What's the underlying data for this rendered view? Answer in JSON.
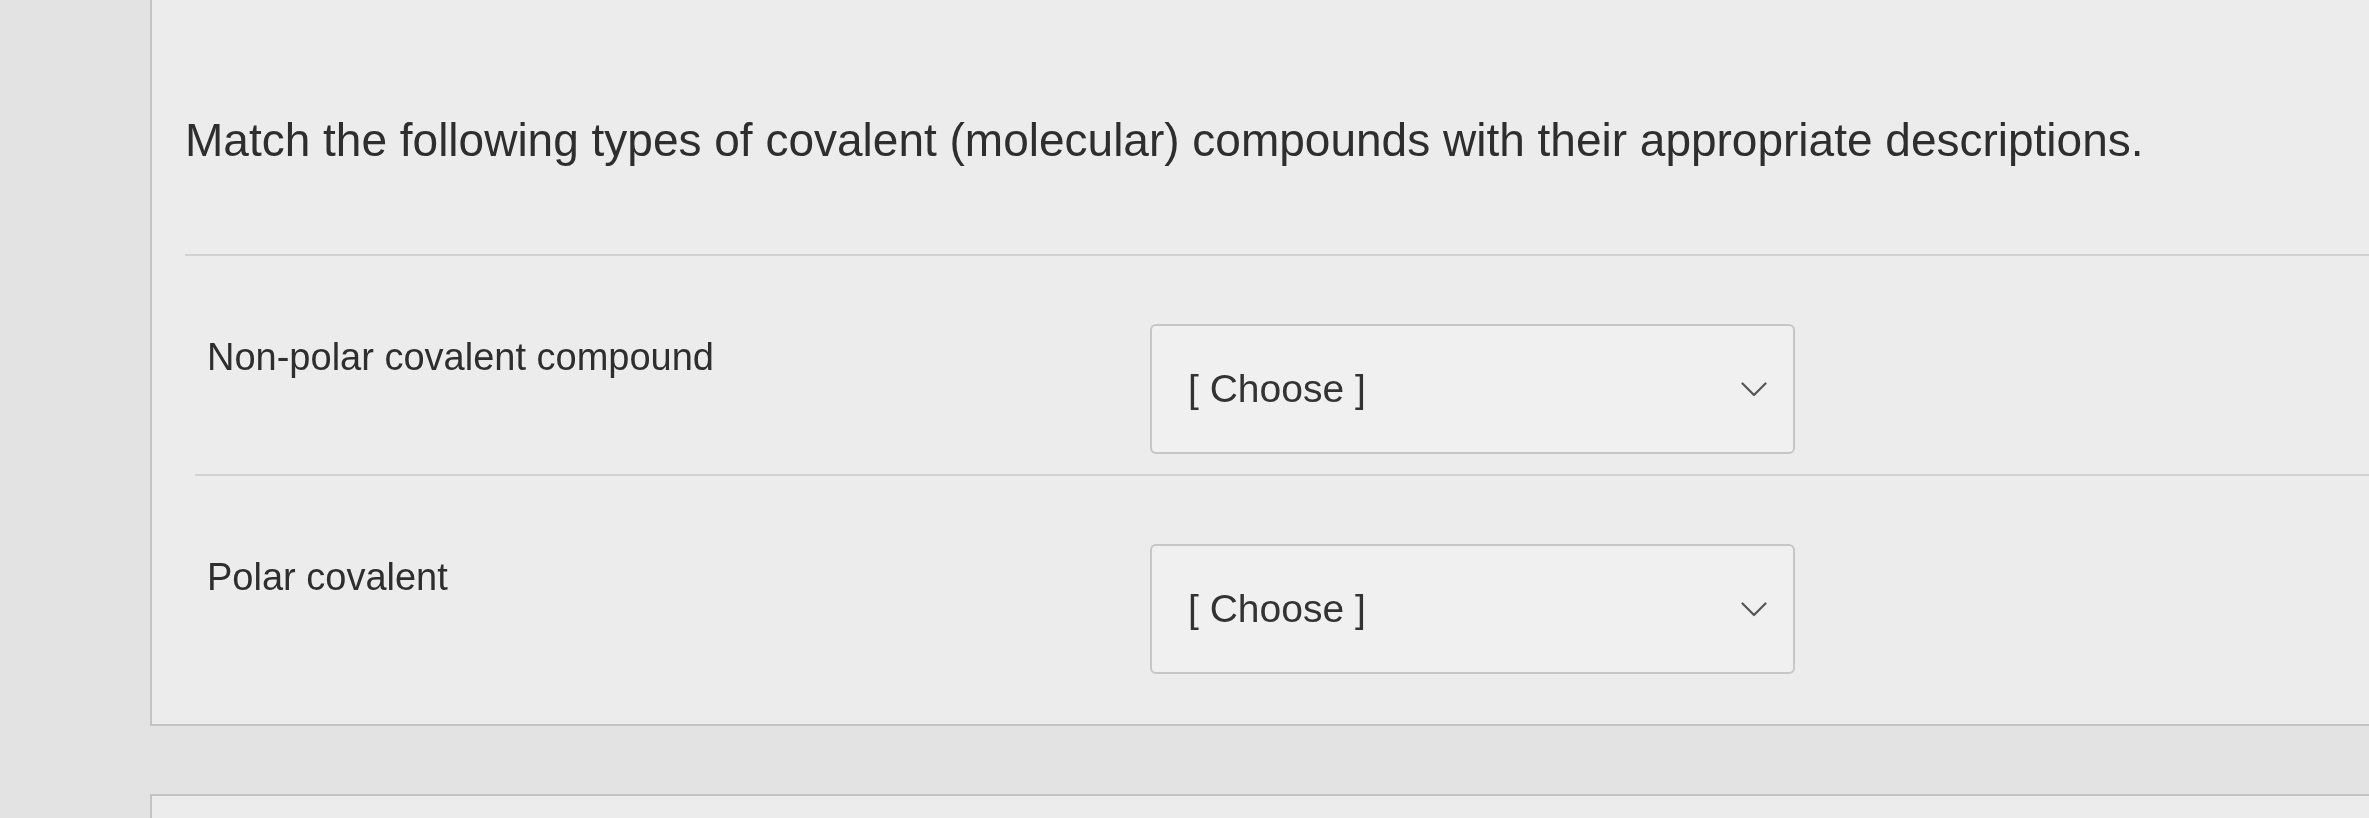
{
  "question": {
    "text": "Match the following types of covalent (molecular) compounds with their appropriate descriptions."
  },
  "matches": [
    {
      "label": "Non-polar covalent compound",
      "select": {
        "value": "[ Choose ]"
      }
    },
    {
      "label": "Polar covalent",
      "select": {
        "value": "[ Choose ]"
      }
    }
  ]
}
